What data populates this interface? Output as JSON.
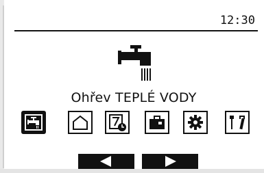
{
  "status": {
    "time": "12:30"
  },
  "main": {
    "title": "Ohřev TEPLÉ VODY"
  },
  "menu": {
    "items": [
      {
        "id": "hot-water",
        "icon": "faucet-icon",
        "selected": true
      },
      {
        "id": "home",
        "icon": "house-icon",
        "selected": false
      },
      {
        "id": "schedule",
        "icon": "calendar-clock-icon",
        "selected": false
      },
      {
        "id": "holiday",
        "icon": "suitcase-icon",
        "selected": false
      },
      {
        "id": "settings",
        "icon": "gear-icon",
        "selected": false
      },
      {
        "id": "service",
        "icon": "tools-icon",
        "selected": false
      }
    ]
  },
  "nav": {
    "left_icon": "arrow-left-icon",
    "right_icon": "arrow-right-icon"
  },
  "colors": {
    "foreground": "#111111",
    "background": "#ffffff"
  }
}
